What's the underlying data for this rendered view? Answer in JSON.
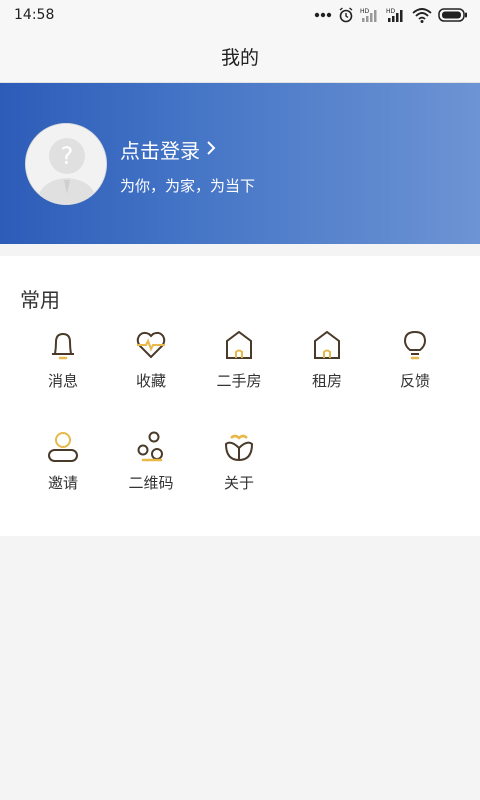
{
  "status_bar": {
    "time": "14:58",
    "signal_badge_1": "HD",
    "signal_badge_2": "HD"
  },
  "nav": {
    "title": "我的"
  },
  "profile": {
    "login_label": "点击登录",
    "slogan": "为你，为家，为当下"
  },
  "common": {
    "title": "常用",
    "items": [
      {
        "label": "消息",
        "icon": "bell-icon"
      },
      {
        "label": "收藏",
        "icon": "heart-icon"
      },
      {
        "label": "二手房",
        "icon": "house-icon"
      },
      {
        "label": "租房",
        "icon": "house-icon"
      },
      {
        "label": "反馈",
        "icon": "lightbulb-icon"
      },
      {
        "label": "邀请",
        "icon": "user-icon"
      },
      {
        "label": "二维码",
        "icon": "circles-icon"
      },
      {
        "label": "关于",
        "icon": "about-icon"
      }
    ]
  },
  "colors": {
    "banner_start": "#2c5cb8",
    "banner_end": "#6d94d4",
    "icon_dark": "#4a3a2a",
    "icon_accent": "#e8b84a"
  }
}
